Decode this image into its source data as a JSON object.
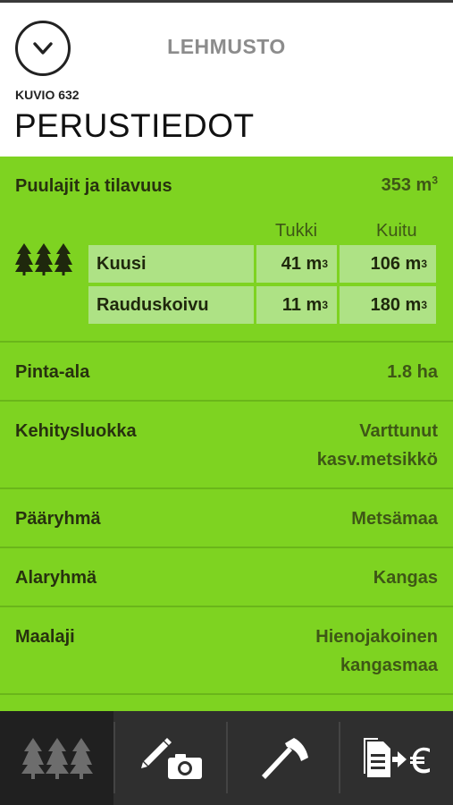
{
  "header": {
    "app_title": "LEHMUSTO",
    "kuvio_label": "KUVIO 632",
    "page_title": "PERUSTIEDOT"
  },
  "species": {
    "label": "Puulajit ja tilavuus",
    "total": "353 m",
    "total_unit_sup": "3",
    "columns": [
      "Tukki",
      "Kuitu"
    ],
    "rows": [
      {
        "name": "Kuusi",
        "tukki": "41 m",
        "kuitu": "106 m"
      },
      {
        "name": "Rauduskoivu",
        "tukki": "11 m",
        "kuitu": "180 m"
      }
    ],
    "unit_sup": "3"
  },
  "fields": [
    {
      "label": "Pinta-ala",
      "value": "1.8 ha"
    },
    {
      "label": "Kehitysluokka",
      "value_line1": "Varttunut",
      "value_line2": "kasv.metsikkö"
    },
    {
      "label": "Pääryhmä",
      "value": "Metsämaa"
    },
    {
      "label": "Alaryhmä",
      "value": "Kangas"
    },
    {
      "label": "Maalaji",
      "value_line1": "Hienojakoinen",
      "value_line2": "kangasmaa"
    }
  ],
  "tabbar": {
    "tabs": [
      {
        "icon": "trees-icon",
        "active": true
      },
      {
        "icon": "pencil-camera-icon",
        "active": false
      },
      {
        "icon": "axe-icon",
        "active": false
      },
      {
        "icon": "document-euro-icon",
        "active": false
      }
    ]
  },
  "colors": {
    "green": "#7ed321",
    "cell": "#aee285",
    "tabbar": "#2f2f2f"
  }
}
